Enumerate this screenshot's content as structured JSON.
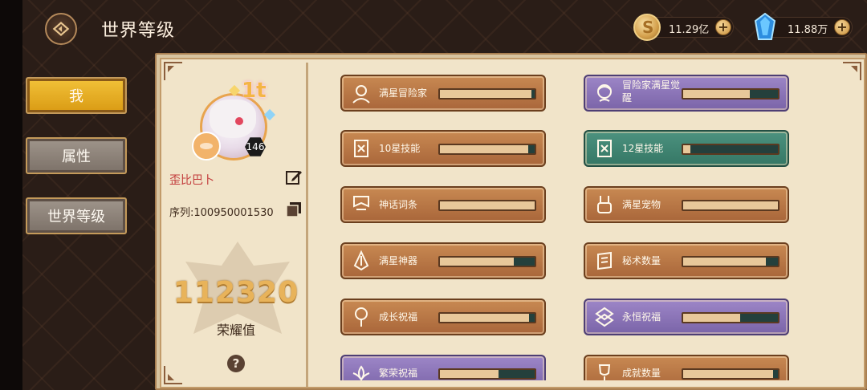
{
  "header": {
    "title": "世界等级"
  },
  "currencies": [
    {
      "name": "gold",
      "value": "11.29亿"
    },
    {
      "name": "crystal",
      "value": "11.88万"
    }
  ],
  "tabs": [
    {
      "label": "我",
      "active": true
    },
    {
      "label": "属性",
      "active": false
    },
    {
      "label": "世界等级",
      "active": false
    }
  ],
  "profile": {
    "badge": "1t",
    "level": "146",
    "username": "歪比巴卜",
    "serial": "序列:100950001530",
    "score": "112320",
    "score_label": "荣耀值",
    "help": "?"
  },
  "items": [
    {
      "label": "满星冒险家",
      "color": "brown",
      "progress": 0.97,
      "icon": "hooded-figure-icon"
    },
    {
      "label": "冒险家满星觉醒",
      "color": "purple",
      "progress": 0.7,
      "icon": "hero-face-icon"
    },
    {
      "label": "10星技能",
      "color": "brown",
      "progress": 0.93,
      "icon": "skill-scroll-icon"
    },
    {
      "label": "12星技能",
      "color": "teal",
      "progress": 0.08,
      "icon": "skill-scroll-icon"
    },
    {
      "label": "神话词条",
      "color": "brown",
      "progress": 1.0,
      "icon": "banner-icon"
    },
    {
      "label": "满星宠物",
      "color": "brown",
      "progress": 1.0,
      "icon": "pet-icon"
    },
    {
      "label": "满星神器",
      "color": "brown",
      "progress": 0.78,
      "icon": "artifact-icon"
    },
    {
      "label": "秘术数量",
      "color": "brown",
      "progress": 0.87,
      "icon": "spell-scroll-icon"
    },
    {
      "label": "成长祝福",
      "color": "brown",
      "progress": 0.94,
      "icon": "tree-icon"
    },
    {
      "label": "永恒祝福",
      "color": "purple",
      "progress": 0.6,
      "icon": "eternal-symbol-icon"
    },
    {
      "label": "繁荣祝福",
      "color": "purple",
      "progress": 0.62,
      "icon": "lotus-icon"
    },
    {
      "label": "成就数量",
      "color": "brown",
      "progress": 0.95,
      "icon": "trophy-icon"
    }
  ]
}
